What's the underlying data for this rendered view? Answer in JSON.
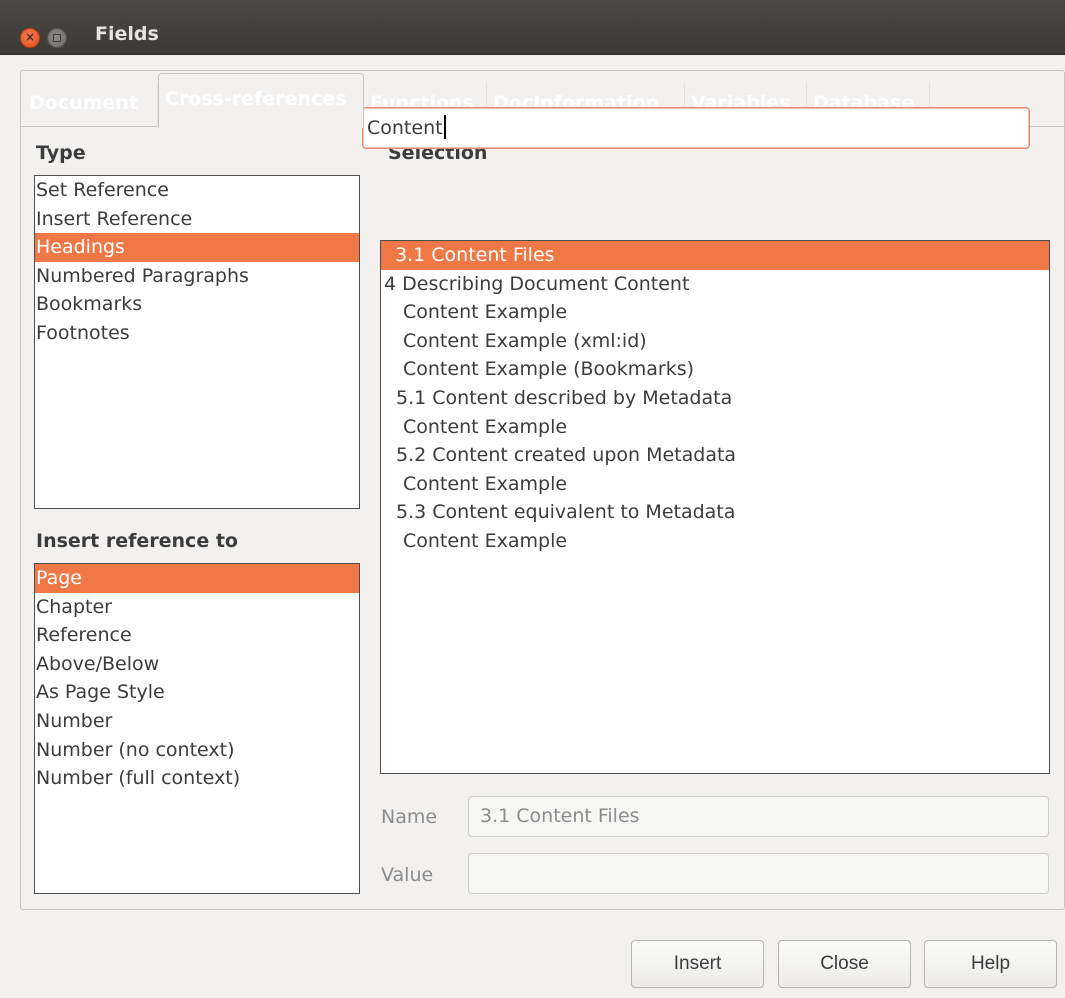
{
  "window": {
    "title": "Fields"
  },
  "tabs": [
    {
      "label": "Document"
    },
    {
      "label": "Cross-references"
    },
    {
      "label": "Functions"
    },
    {
      "label": "DocInformation"
    },
    {
      "label": "Variables"
    },
    {
      "label": "Database"
    }
  ],
  "active_tab": "Cross-references",
  "type_panel": {
    "label": "Type",
    "items": [
      "Set Reference",
      "Insert Reference",
      "Headings",
      "Numbered Paragraphs",
      "Bookmarks",
      "Footnotes"
    ],
    "selected": "Headings"
  },
  "insert_ref_panel": {
    "label": "Insert reference to",
    "items": [
      "Page",
      "Chapter",
      "Reference",
      "Above/Below",
      "As Page Style",
      "Number",
      "Number (no context)",
      "Number (full context)"
    ],
    "selected": "Page"
  },
  "selection_panel": {
    "label": "Selection",
    "search_value": "Content",
    "items": [
      "3.1 Content Files",
      "4 Describing Document Content",
      "Content Example",
      "Content Example (xml:id)",
      "Content Example (Bookmarks)",
      "5.1 Content described by Metadata",
      "Content Example",
      "5.2 Content created upon Metadata",
      "Content Example",
      "5.3 Content equivalent to Metadata",
      "Content Example"
    ],
    "selected": "3.1 Content Files"
  },
  "fields": {
    "name_label": "Name",
    "name_value": "3.1 Content Files",
    "value_label": "Value",
    "value_value": ""
  },
  "buttons": {
    "insert": "Insert",
    "close": "Close",
    "help": "Help"
  },
  "colors": {
    "selection": "#f07746",
    "titlebar": "#3c3b37",
    "tab_text": "#ffffff"
  }
}
